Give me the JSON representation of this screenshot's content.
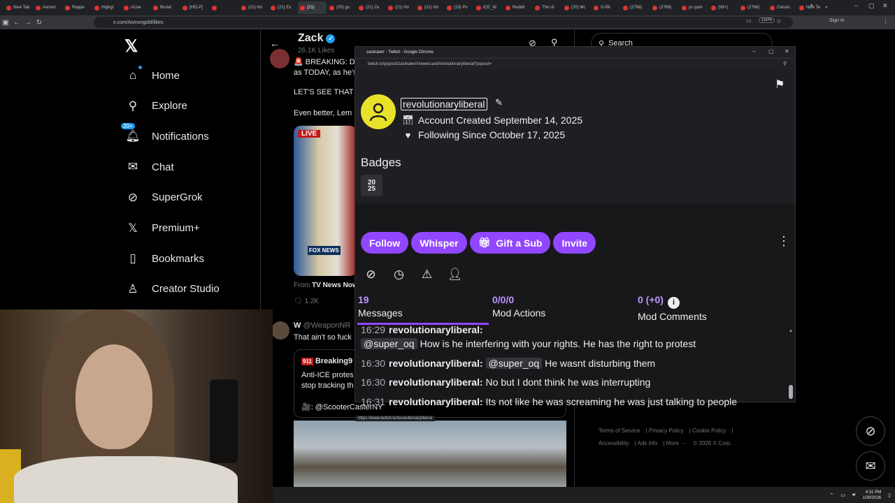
{
  "browser": {
    "tabs": [
      "New Tab",
      "Asmon",
      "Rappe",
      "Highgr",
      "r/Live",
      "Brutal",
      "[HELP]",
      "",
      "(21) Ho",
      "(21) Ex",
      "(21)",
      "(20) go",
      "(21) Ze",
      "(21) Ho",
      "(21) Ho",
      "(19) Po",
      "ICE_W",
      "Reddit",
      "The cli",
      "(20) Mc",
      "G-Rk",
      "(2768)",
      "(2769)",
      "pc gam",
      "(99+)",
      "(2768)",
      "Classic",
      "New Ta"
    ],
    "active_tab_index": 10,
    "url": "x.com/Asmongold/likes",
    "zoom": "150%",
    "sign_in": "Sign in"
  },
  "x_sidebar": {
    "items": [
      {
        "label": "Home",
        "icon": "home-icon"
      },
      {
        "label": "Explore",
        "icon": "search-icon"
      },
      {
        "label": "Notifications",
        "icon": "bell-icon",
        "badge": "20+"
      },
      {
        "label": "Chat",
        "icon": "mail-icon"
      },
      {
        "label": "SuperGrok",
        "icon": "grok-icon"
      },
      {
        "label": "Premium+",
        "icon": "x-icon"
      },
      {
        "label": "Bookmarks",
        "icon": "bookmark-icon"
      },
      {
        "label": "Creator Studio",
        "icon": "creator-icon"
      }
    ]
  },
  "feed": {
    "profile_name": "Zack",
    "likes_count": "26.1K Likes",
    "tweet1_line1": "🚨 BREAKING: D",
    "tweet1_line2": "as TODAY, as he's",
    "tweet1_line3": "LET'S SEE THAT H",
    "tweet1_line4": "Even better, Lem",
    "live_tag": "LIVE",
    "fox_tag": "FOX NEWS",
    "from_prefix": "From",
    "from_source": "TV News Now",
    "reply_count": "1.2K",
    "tweet2_name": "W",
    "tweet2_handle": "@WeaponNR",
    "tweet2_text": "That ain't so fuck",
    "quote_badge": "911",
    "quote_name": "Breaking9",
    "quote_line1": "Anti-ICE protes",
    "quote_line2": "stop tracking th",
    "quote_credit": "🎥: @ScooterCasterNY"
  },
  "right_column": {
    "search_placeholder": "Search",
    "footer": [
      "Terms of Service",
      "Privacy Policy",
      "Cookie Policy",
      "Accessibility",
      "Ads info",
      "More ···",
      "© 2026 X Corp."
    ]
  },
  "popup": {
    "window_title": "zackrawrr - Twitch - Google Chrome",
    "url": "twitch.tv/popout/zackrawrr/viewercard/revolutionaryliberal?popout=",
    "username": "revolutionaryliberal",
    "account_created": "Account Created September 14, 2025",
    "following_since": "Following Since October 17, 2025",
    "badges_title": "Badges",
    "badge_text": "20\n25",
    "buttons": {
      "follow": "Follow",
      "whisper": "Whisper",
      "gift": "Gift a Sub",
      "invite": "Invite"
    },
    "stats": [
      {
        "value": "19",
        "label": "Messages"
      },
      {
        "value": "0/0/0",
        "label": "Mod Actions"
      },
      {
        "value": "0 (+0)",
        "label": "Mod Comments"
      }
    ],
    "messages": [
      {
        "time": "16:29",
        "user": "revolutionaryliberal:",
        "mention": "",
        "text": ""
      },
      {
        "time": "",
        "user": "",
        "mention": "@super_oq",
        "text": "How is he interfering with your rights. He has the right to protest"
      },
      {
        "time": "16:30",
        "user": "revolutionaryliberal:",
        "mention": "@super_oq",
        "text": "He wasnt disturbing them"
      },
      {
        "time": "16:30",
        "user": "revolutionaryliberal:",
        "mention": "",
        "text": "No but I dont think he was interrupting"
      },
      {
        "time": "16:31",
        "user": "revolutionaryliberal:",
        "mention": "",
        "text": "Its not like he was screaming he was just talking to people"
      }
    ],
    "status_url": "https://www.twitch.tv/revolutionaryliberal",
    "accent": "#9147ff"
  },
  "taskbar": {
    "time": "4:31 PM",
    "date": "1/30/2026"
  }
}
